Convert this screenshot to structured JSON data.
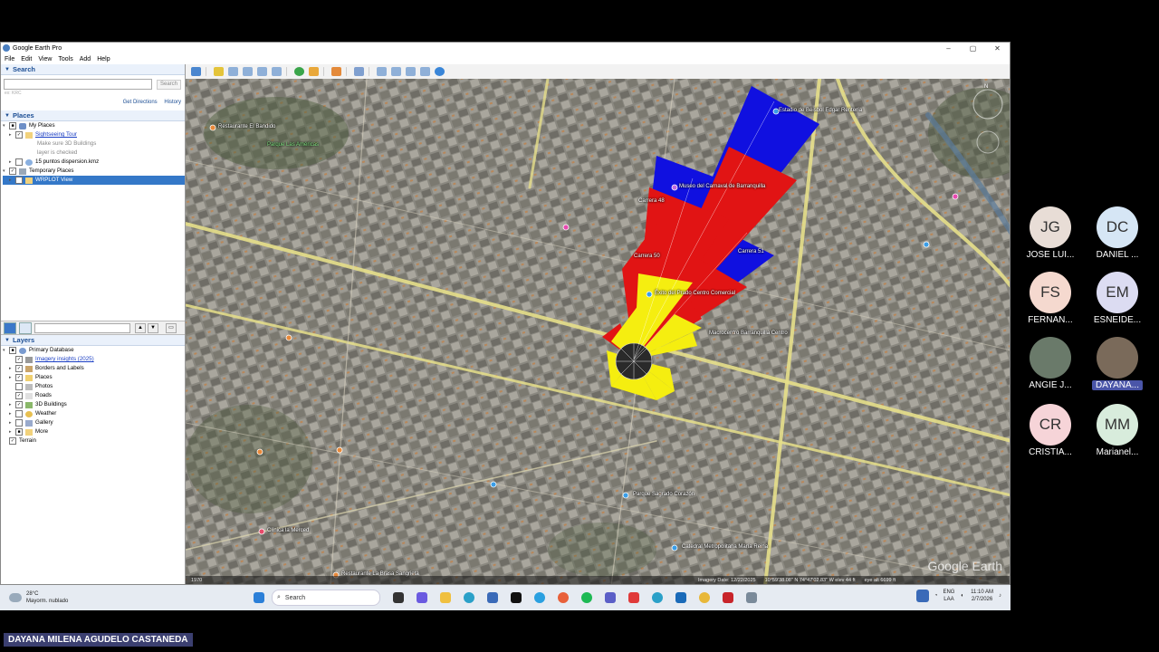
{
  "window": {
    "title": "Google Earth Pro",
    "min": "–",
    "max": "▢",
    "close": "✕"
  },
  "menu": [
    "File",
    "Edit",
    "View",
    "Tools",
    "Add",
    "Help"
  ],
  "search_panel": {
    "heading": "Search",
    "button": "Search",
    "hint": "ex: KRC",
    "get_directions": "Get Directions",
    "history": "History"
  },
  "places_panel": {
    "heading": "Places",
    "items": [
      {
        "label": "My Places"
      },
      {
        "label": "Sightseeing Tour"
      },
      {
        "label": "Make sure 3D Buildings"
      },
      {
        "label": "layer is checked"
      },
      {
        "label": "15 puntos dispersion.kmz"
      },
      {
        "label": "Temporary Places"
      },
      {
        "label": "WRPLOT View"
      }
    ]
  },
  "layers_panel": {
    "heading": "Layers",
    "items": [
      {
        "label": "Primary Database"
      },
      {
        "label": "Imagery insights (2025)"
      },
      {
        "label": "Borders and Labels"
      },
      {
        "label": "Places"
      },
      {
        "label": "Photos"
      },
      {
        "label": "Roads"
      },
      {
        "label": "3D Buildings"
      },
      {
        "label": "Weather"
      },
      {
        "label": "Gallery"
      },
      {
        "label": "More"
      },
      {
        "label": "Terrain"
      }
    ]
  },
  "map_labels": {
    "parque": "Parque Las Américas",
    "estadio": "Estadio de Béisbol Edgar Rentería",
    "museo": "Museo del Carnaval de Barranquilla",
    "carrera51": "Carrera 51",
    "carrera50": "Carrera 50",
    "carrera48": "Carrera 48",
    "prado": "Éxito del Prado Centro Comercial",
    "manzana": "Macrocentro Barranquilla Centro",
    "restaurante1": "Restaurante El Bandido",
    "clinica": "Clínica la Merced",
    "restaurante2": "Restaurante La Brasa Sangrieta",
    "catedral": "Catedral Metropolitana María Reina",
    "parque2": "Parque Sagrado Corazón"
  },
  "status": {
    "imagery_date": "Imagery Date: 12/22/2025",
    "coords": "10°59'38.08\" N  74°47'02.83\" W  elev  44 ft",
    "eye_alt": "eye alt  6699 ft",
    "year": "1970"
  },
  "watermark": "Google Earth",
  "taskbar": {
    "temp": "28°C",
    "weather_desc": "Mayorm. nublado",
    "search": "Search",
    "lang1": "ENG",
    "lang2": "LAA",
    "time": "11:10 AM",
    "date": "2/7/2026"
  },
  "participants": [
    {
      "initials": "JG",
      "name": "JOSE LUI...",
      "color": "#e8ddd6"
    },
    {
      "initials": "DC",
      "name": "DANIEL ...",
      "color": "#d6e6f5"
    },
    {
      "initials": "FS",
      "name": "FERNAN...",
      "color": "#f5d9cf"
    },
    {
      "initials": "EM",
      "name": "ESNEIDE...",
      "color": "#dcdcf2"
    },
    {
      "initials": "",
      "name": "ANGIE J...",
      "color": "#6a7a6a"
    },
    {
      "initials": "",
      "name": "DAYANA...",
      "color": "#7a6a5a"
    },
    {
      "initials": "CR",
      "name": "CRISTIA...",
      "color": "#f6d4d8"
    },
    {
      "initials": "MM",
      "name": "Marianel...",
      "color": "#d8ecdc"
    }
  ],
  "name_tag": "DAYANA MILENA AGUDELO CASTANEDA"
}
